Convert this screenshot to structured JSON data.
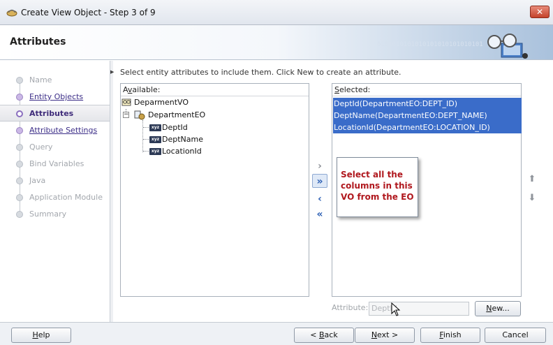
{
  "window": {
    "title": "Create View Object - Step 3 of 9",
    "close_label": "✕"
  },
  "header": {
    "title": "Attributes",
    "binary_text": "0101010101010101010101010101"
  },
  "nav": {
    "items": [
      {
        "label": "Name",
        "state": "disabled"
      },
      {
        "label": "Entity Objects",
        "state": "link"
      },
      {
        "label": "Attributes",
        "state": "current"
      },
      {
        "label": "Attribute Settings",
        "state": "link"
      },
      {
        "label": "Query",
        "state": "disabled"
      },
      {
        "label": "Bind Variables",
        "state": "disabled"
      },
      {
        "label": "Java",
        "state": "disabled"
      },
      {
        "label": "Application Module",
        "state": "disabled"
      },
      {
        "label": "Summary",
        "state": "disabled"
      }
    ]
  },
  "instruction": "Select entity attributes to include them.  Click New to create an attribute.",
  "available": {
    "label_prefix": "A",
    "label_underlined": "v",
    "label_suffix": "ailable:",
    "root": "DeparmentVO",
    "entity": "DepartmentEO",
    "attributes": [
      "DeptId",
      "DeptName",
      "LocationId"
    ],
    "attr_icon_text": "xyz"
  },
  "selected": {
    "label_underlined": "S",
    "label_suffix": "elected:",
    "items": [
      "DeptId(DepartmentEO:DEPT_ID)",
      "DeptName(DepartmentEO:DEPT_NAME)",
      "LocationId(DepartmentEO:LOCATION_ID)"
    ]
  },
  "shuttle": {
    "move": "›",
    "move_all": "»",
    "remove": "‹",
    "remove_all": "«"
  },
  "reorder": {
    "up": "⬆",
    "down": "⬇"
  },
  "callout": {
    "text": "Select all the columns in this VO from the EO"
  },
  "attribute_field": {
    "label": "Attribute:",
    "value": "DeptId"
  },
  "buttons": {
    "new_u": "N",
    "new_rest": "ew...",
    "help_u": "H",
    "help_rest": "elp",
    "back_pre": "< ",
    "back_u": "B",
    "back_rest": "ack",
    "next_u": "N",
    "next_rest": "ext >",
    "finish_u": "F",
    "finish_rest": "inish",
    "cancel": "Cancel"
  },
  "colors": {
    "selection": "#3a6cc9",
    "callout_text": "#b0181e",
    "link": "#3c2e88"
  }
}
